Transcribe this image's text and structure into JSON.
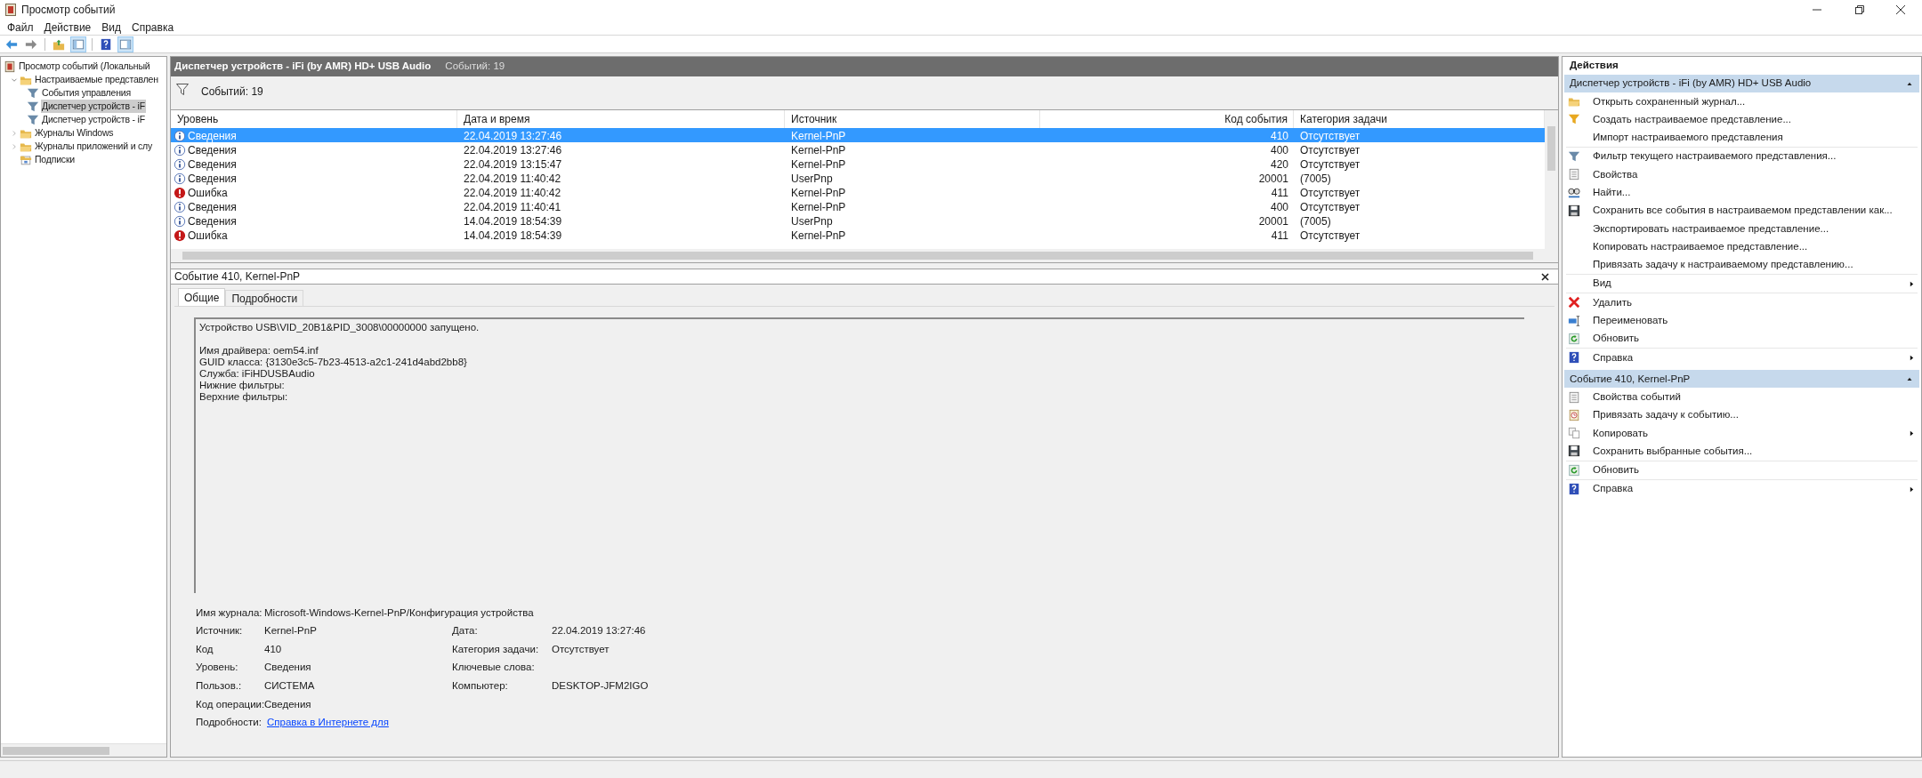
{
  "window": {
    "title": "Просмотр событий"
  },
  "menu": [
    "Файл",
    "Действие",
    "Вид",
    "Справка"
  ],
  "toolbar": [
    {
      "kind": "back",
      "pressed": false
    },
    {
      "kind": "forward",
      "pressed": false
    },
    {
      "kind": "up",
      "pressed": false
    },
    {
      "kind": "tree",
      "pressed": true
    },
    {
      "kind": "help",
      "pressed": false
    },
    {
      "kind": "pane",
      "pressed": true
    }
  ],
  "tree": [
    {
      "label": "Просмотр событий (Локальный",
      "kind": "viewer",
      "selected": false,
      "children": [
        {
          "label": "Настраиваемые представлен",
          "kind": "folder",
          "expanded": true,
          "selected": false,
          "children": [
            {
              "label": "События управления",
              "kind": "filter",
              "selected": false
            },
            {
              "label": "Диспетчер устройств - iF",
              "kind": "filter",
              "selected": true
            },
            {
              "label": "Диспетчер устройств - iF",
              "kind": "filter",
              "selected": false
            }
          ]
        },
        {
          "label": "Журналы Windows",
          "kind": "folder",
          "expanded": false,
          "selected": false
        },
        {
          "label": "Журналы приложений и слу",
          "kind": "folder",
          "expanded": false,
          "selected": false
        },
        {
          "label": "Подписки",
          "kind": "subs",
          "selected": false
        }
      ]
    }
  ],
  "view": {
    "title": "Диспетчер устройств - iFi (by AMR) HD+ USB Audio",
    "count": "Событий: 19",
    "filter_count": "Событий: 19"
  },
  "table": {
    "columns": [
      "Уровень",
      "Дата и время",
      "Источник",
      "Код события",
      "Категория задачи"
    ],
    "rows": [
      {
        "kind": "info",
        "level": "Сведения",
        "date": "22.04.2019 13:27:46",
        "source": "Kernel-PnP",
        "code": "410",
        "category": "Отсутствует",
        "selected": true
      },
      {
        "kind": "info",
        "level": "Сведения",
        "date": "22.04.2019 13:27:46",
        "source": "Kernel-PnP",
        "code": "400",
        "category": "Отсутствует",
        "selected": false
      },
      {
        "kind": "info",
        "level": "Сведения",
        "date": "22.04.2019 13:15:47",
        "source": "Kernel-PnP",
        "code": "420",
        "category": "Отсутствует",
        "selected": false
      },
      {
        "kind": "info",
        "level": "Сведения",
        "date": "22.04.2019 11:40:42",
        "source": "UserPnp",
        "code": "20001",
        "category": "(7005)",
        "selected": false
      },
      {
        "kind": "error",
        "level": "Ошибка",
        "date": "22.04.2019 11:40:42",
        "source": "Kernel-PnP",
        "code": "411",
        "category": "Отсутствует",
        "selected": false
      },
      {
        "kind": "info",
        "level": "Сведения",
        "date": "22.04.2019 11:40:41",
        "source": "Kernel-PnP",
        "code": "400",
        "category": "Отсутствует",
        "selected": false
      },
      {
        "kind": "info",
        "level": "Сведения",
        "date": "14.04.2019 18:54:39",
        "source": "UserPnp",
        "code": "20001",
        "category": "(7005)",
        "selected": false
      },
      {
        "kind": "error",
        "level": "Ошибка",
        "date": "14.04.2019 18:54:39",
        "source": "Kernel-PnP",
        "code": "411",
        "category": "Отсутствует",
        "selected": false
      }
    ]
  },
  "detail": {
    "title": "Событие 410, Kernel-PnP",
    "tabs": [
      {
        "label": "Общие",
        "selected": true
      },
      {
        "label": "Подробности",
        "selected": false
      }
    ],
    "description": "Устройство USB\\VID_20B1&PID_3008\\00000000 запущено.\n\nИмя драйвера: oem54.inf\nGUID класса: {3130e3c5-7b23-4513-a2c1-241d4abd2bb8}\nСлужба: iFiHDUSBAudio\nНижние фильтры:\nВерхние фильтры:",
    "fields": [
      [
        {
          "label": "Имя журнала:",
          "value": "Microsoft-Windows-Kernel-PnP/Конфигурация устройства"
        }
      ],
      [
        {
          "label": "Источник:",
          "value": "Kernel-PnP"
        },
        {
          "label": "Дата:",
          "value": "22.04.2019 13:27:46"
        }
      ],
      [
        {
          "label": "Код",
          "value": "410"
        },
        {
          "label": "Категория задачи:",
          "value": "Отсутствует"
        }
      ],
      [
        {
          "label": "Уровень:",
          "value": "Сведения"
        },
        {
          "label": "Ключевые слова:"
        }
      ],
      [
        {
          "label": "Пользов.:",
          "value": "СИСТЕМА"
        },
        {
          "label": "Компьютер:",
          "value": "DESKTOP-JFM2IGO"
        }
      ],
      [
        {
          "label": "Код операции:",
          "value": "Сведения"
        }
      ],
      [
        {
          "label": "Подробности:",
          "value": "Справка в Интернете для",
          "kind": "link"
        }
      ]
    ]
  },
  "actions": {
    "title": "Действия",
    "sections": [
      {
        "title": "Диспетчер устройств - iFi (by AMR) HD+ USB Audio",
        "expanded": true,
        "groups": [
          [
            {
              "label": "Открыть сохраненный журнал...",
              "kind": "folder",
              "submenu": false
            },
            {
              "label": "Создать настраиваемое представление...",
              "kind": "filter-new",
              "submenu": false
            },
            {
              "label": "Импорт настраиваемого представления",
              "kind": "plain",
              "submenu": false
            }
          ],
          [
            {
              "label": "Фильтр текущего настраиваемого представления...",
              "kind": "filter",
              "submenu": false
            },
            {
              "label": "Свойства",
              "kind": "props",
              "submenu": false
            },
            {
              "label": "Найти...",
              "kind": "find",
              "submenu": false
            },
            {
              "label": "Сохранить все события в настраиваемом представлении как...",
              "kind": "save",
              "submenu": false
            },
            {
              "label": "Экспортировать настраиваемое представление...",
              "kind": "plain",
              "submenu": false
            },
            {
              "label": "Копировать настраиваемое представление...",
              "kind": "plain",
              "submenu": false
            },
            {
              "label": "Привязать задачу к настраиваемому представлению...",
              "kind": "plain",
              "submenu": false
            }
          ],
          [
            {
              "label": "Вид",
              "kind": "plain",
              "submenu": true
            }
          ],
          [
            {
              "label": "Удалить",
              "kind": "delete",
              "submenu": false
            },
            {
              "label": "Переименовать",
              "kind": "rename",
              "submenu": false
            },
            {
              "label": "Обновить",
              "kind": "refresh",
              "submenu": false
            }
          ],
          [
            {
              "label": "Справка",
              "kind": "help",
              "submenu": true
            }
          ]
        ]
      },
      {
        "title": "Событие 410, Kernel-PnP",
        "expanded": true,
        "groups": [
          [
            {
              "label": "Свойства событий",
              "kind": "props",
              "submenu": false
            },
            {
              "label": "Привязать задачу к событию...",
              "kind": "task",
              "submenu": false
            },
            {
              "label": "Копировать",
              "kind": "copy",
              "submenu": true
            },
            {
              "label": "Сохранить выбранные события...",
              "kind": "save",
              "submenu": false
            }
          ],
          [
            {
              "label": "Обновить",
              "kind": "refresh",
              "submenu": false
            }
          ],
          [
            {
              "label": "Справка",
              "kind": "help",
              "submenu": true
            }
          ]
        ]
      }
    ]
  }
}
